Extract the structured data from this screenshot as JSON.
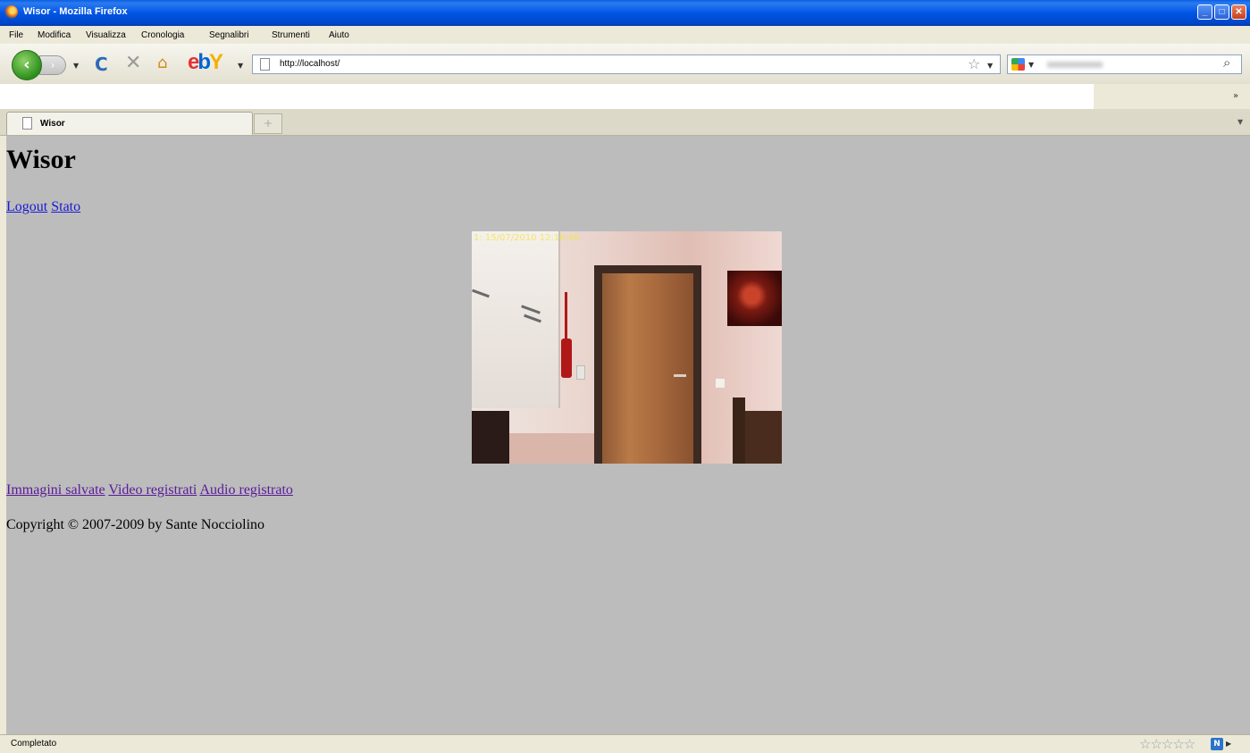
{
  "window": {
    "title": "Wisor - Mozilla Firefox",
    "minimize": "_",
    "maximize": "□",
    "close": "✕"
  },
  "menu": {
    "items": [
      "File",
      "Modifica",
      "Visualizza",
      "Cronologia",
      "Segnalibri",
      "Strumenti",
      "Aiuto"
    ]
  },
  "toolbar": {
    "back": "‹",
    "forward": "›",
    "url": "http://localhost/"
  },
  "tabs": [
    {
      "label": "Wisor"
    }
  ],
  "page": {
    "title": "Wisor",
    "top_links": [
      "Logout",
      "Stato"
    ],
    "camera_timestamp": "1: 15/07/2010 12:16:46",
    "bottom_links": [
      "Immagini salvate",
      "Video registrati",
      "Audio registrato"
    ],
    "copyright": "Copyright © 2007-2009 by Sante Nocciolino"
  },
  "statusbar": {
    "text": "Completato",
    "rating_stars": "☆☆☆☆☆"
  },
  "colors": {
    "titlebar": "#0055e5",
    "content_bg": "#bcbcbc",
    "link": "#1a1ad4",
    "visited_link": "#5a1a9a",
    "timestamp": "#f4e64a"
  }
}
